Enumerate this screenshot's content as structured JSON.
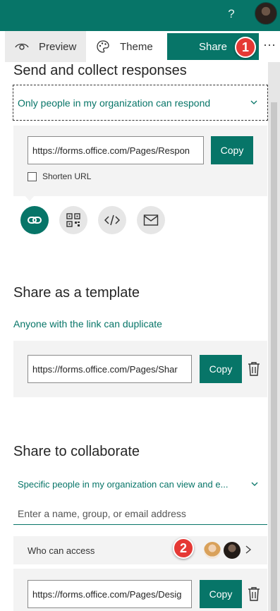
{
  "topbar": {
    "help_label": "?"
  },
  "toolbar": {
    "preview_label": "Preview",
    "theme_label": "Theme",
    "share_label": "Share",
    "more_label": "···"
  },
  "badges": {
    "first": "1",
    "second": "2"
  },
  "send_section": {
    "heading": "Send and collect responses",
    "permission": "Only people in my organization can respond",
    "url": "https://forms.office.com/Pages/Respon",
    "copy_label": "Copy",
    "shorten_label": "Shorten URL",
    "share_methods": [
      "link-icon",
      "qr-code-icon",
      "embed-code-icon",
      "email-icon"
    ]
  },
  "template_section": {
    "heading": "Share as a template",
    "permission": "Anyone with the link can duplicate",
    "url": "https://forms.office.com/Pages/Shar",
    "copy_label": "Copy"
  },
  "collab_section": {
    "heading": "Share to collaborate",
    "permission": "Specific people in my organization can view and e...",
    "people_placeholder": "Enter a name, group, or email address",
    "who_label": "Who can access",
    "url": "https://forms.office.com/Pages/Desig",
    "copy_label": "Copy"
  },
  "colors": {
    "accent": "#077568",
    "badge": "#e53935"
  }
}
